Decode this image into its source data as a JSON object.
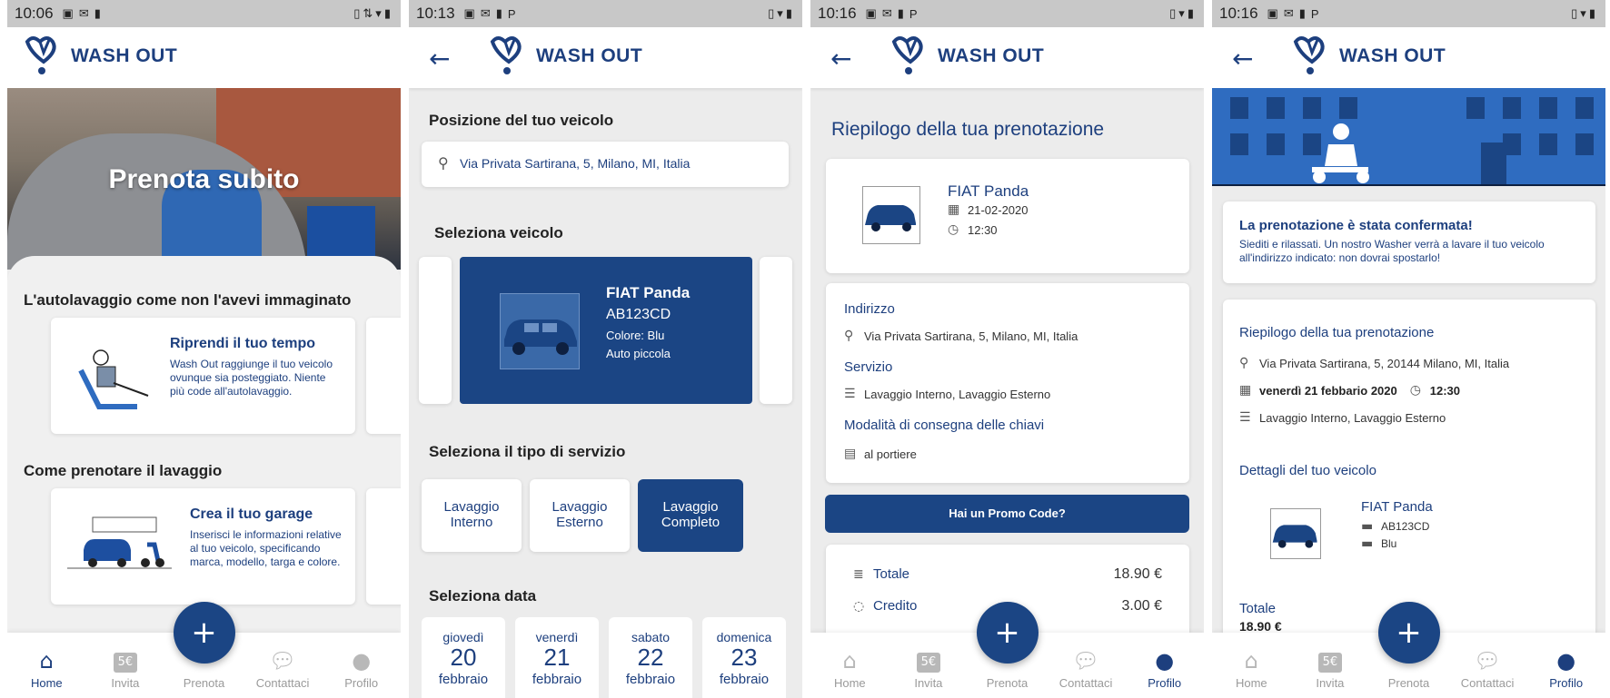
{
  "brand": {
    "name": "WASH OUT",
    "primary": "#1b4584",
    "text": "#1d3f7e"
  },
  "nav": {
    "home": "Home",
    "invita": "Invita",
    "prenota": "Prenota",
    "contattaci": "Contattaci",
    "profilo": "Profilo",
    "fab": "+",
    "invita_badge": "5€"
  },
  "s1": {
    "time": "10:06",
    "hero_title": "Prenota subito",
    "section1_title": "L'autolavaggio come non l'avevi immaginato",
    "card1_title": "Riprendi il tuo tempo",
    "card1_text": "Wash Out raggiunge il tuo veicolo ovunque sia posteggiato. Niente più code all'autolavaggio.",
    "section2_title": "Come prenotare il lavaggio",
    "card2_title": "Crea il tuo garage",
    "card2_text": "Inserisci le informazioni relative al tuo veicolo, specificando marca, modello, targa e colore."
  },
  "s2": {
    "time": "10:13",
    "position_title": "Posizione del tuo veicolo",
    "address": "Via Privata Sartirana, 5, Milano, MI, Italia",
    "vehicle_title": "Seleziona veicolo",
    "vehicle_name": "FIAT Panda",
    "vehicle_plate": "AB123CD",
    "vehicle_color": "Colore: Blu",
    "vehicle_type": "Auto piccola",
    "service_title": "Seleziona il tipo di servizio",
    "services": [
      {
        "l1": "Lavaggio",
        "l2": "Interno"
      },
      {
        "l1": "Lavaggio",
        "l2": "Esterno"
      },
      {
        "l1": "Lavaggio",
        "l2": "Completo"
      }
    ],
    "date_title": "Seleziona data",
    "dates": [
      {
        "day": "giovedì",
        "num": "20",
        "month": "febbraio"
      },
      {
        "day": "venerdì",
        "num": "21",
        "month": "febbraio"
      },
      {
        "day": "sabato",
        "num": "22",
        "month": "febbraio"
      },
      {
        "day": "domenica",
        "num": "23",
        "month": "febbraio"
      }
    ]
  },
  "s3": {
    "time": "10:16",
    "title": "Riepilogo della tua prenotazione",
    "vehicle_name": "FIAT Panda",
    "date": "21-02-2020",
    "time_slot": "12:30",
    "address_label": "Indirizzo",
    "address": "Via Privata Sartirana, 5, Milano, MI, Italia",
    "service_label": "Servizio",
    "service": "Lavaggio Interno, Lavaggio Esterno",
    "keys_label": "Modalità di consegna delle chiavi",
    "keys": "al portiere",
    "promo_button": "Hai un Promo Code?",
    "total_label": "Totale",
    "total_value": "18.90 €",
    "credit_label": "Credito",
    "credit_value": "3.00 €"
  },
  "s4": {
    "time": "10:16",
    "confirm_title": "La prenotazione è stata confermata!",
    "confirm_text": "Siediti e rilassati. Un nostro Washer verrà a lavare il tuo veicolo all'indirizzo indicato: non dovrai spostarlo!",
    "summary_title": "Riepilogo della tua prenotazione",
    "address": "Via Privata Sartirana, 5, 20144 Milano, MI, Italia",
    "date": "venerdì 21 febbario 2020",
    "time_slot": "12:30",
    "service": "Lavaggio Interno, Lavaggio Esterno",
    "vehicle_title": "Dettagli del tuo veicolo",
    "vehicle_name": "FIAT Panda",
    "vehicle_plate": "AB123CD",
    "vehicle_color": "Blu",
    "total_label": "Totale",
    "total_value": "18.90 €"
  }
}
